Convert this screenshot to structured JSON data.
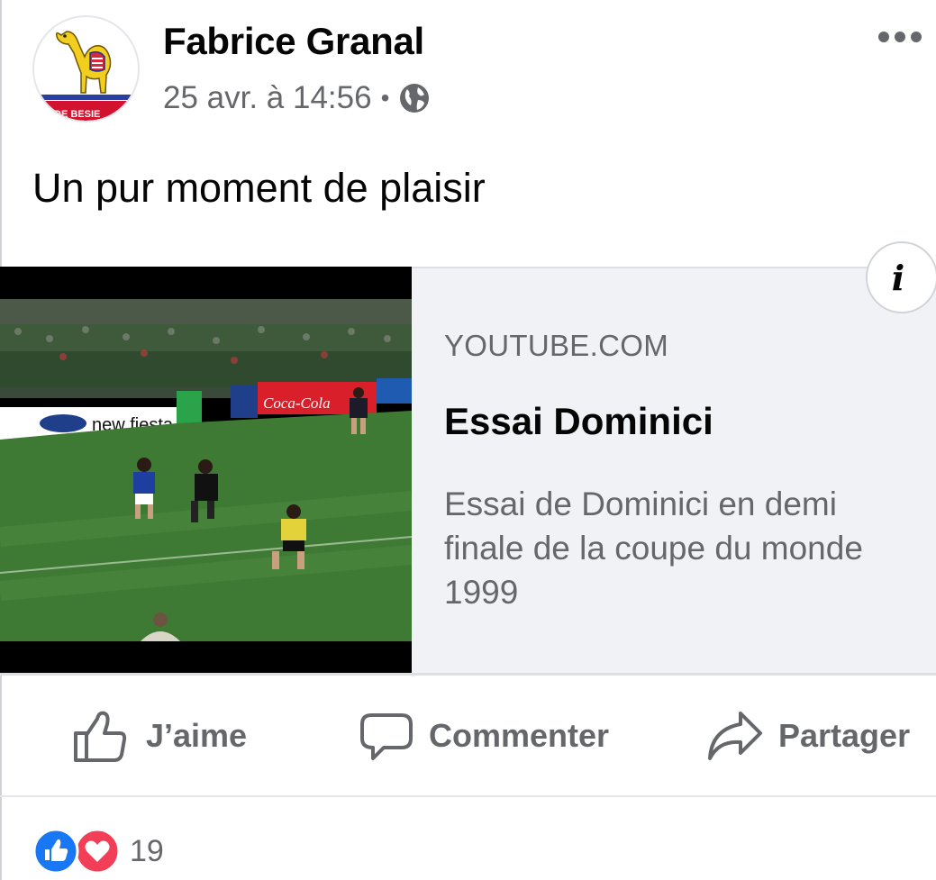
{
  "post": {
    "author": "Fabrice Granal",
    "timestamp": "25 avr. à 14:56",
    "separator": "•",
    "privacy_icon": "globe-icon",
    "menu_icon": "more-dots-icon",
    "avatar": {
      "badge_text": "DE BESIE",
      "emblem_icon": "camel-logo"
    },
    "text": "Un pur moment de plaisir"
  },
  "link_card": {
    "domain": "YOUTUBE.COM",
    "title": "Essai Dominici",
    "description": "Essai de Dominici en demi finale de la coupe du monde 1999",
    "info_icon": "info-icon",
    "thumbnail": {
      "ad_boards": [
        "new fiesta",
        "Coca-Cola",
        "Coca-Cola"
      ],
      "colors": {
        "pitch": "#3f7a34",
        "crowd": "#3a4a3a"
      }
    }
  },
  "actions": {
    "like": "J’aime",
    "comment": "Commenter",
    "share": "Partager"
  },
  "reactions": {
    "count": "19",
    "types": [
      "like-reaction-icon",
      "love-reaction-icon"
    ]
  },
  "colors": {
    "text_primary": "#050505",
    "text_secondary": "#65676b",
    "card_background": "#f0f2f5",
    "like_blue": "#1877f2",
    "love_red": "#f33e58"
  }
}
